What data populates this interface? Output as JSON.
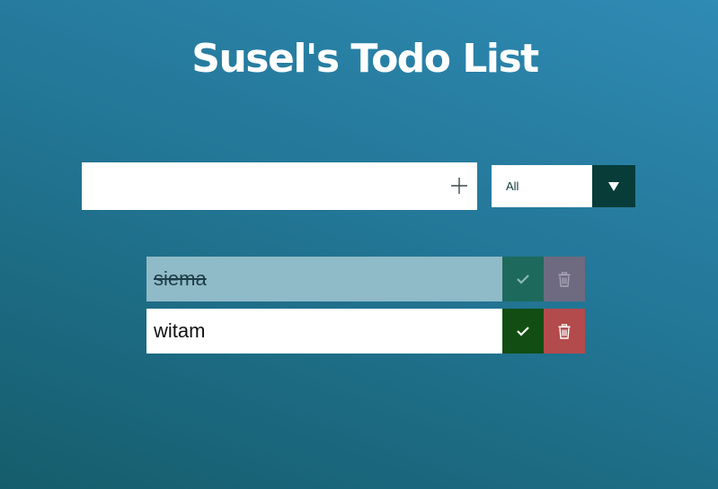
{
  "app": {
    "title": "Susel's Todo List"
  },
  "form": {
    "input_value": "",
    "input_placeholder": "",
    "add_icon": "plus-icon",
    "filter_selected": "All",
    "filter_arrow_icon": "triangle-down-icon"
  },
  "todos": [
    {
      "text": "siema",
      "completed": true,
      "check_icon": "check-icon",
      "delete_icon": "trash-icon"
    },
    {
      "text": "witam",
      "completed": false,
      "check_icon": "check-icon",
      "delete_icon": "trash-icon"
    }
  ],
  "colors": {
    "background_start": "#2f8ab4",
    "background_end": "#155d6c",
    "check_active": "#124e13",
    "delete_active": "#b34a4c",
    "select_arrow_bg": "#073c39"
  }
}
